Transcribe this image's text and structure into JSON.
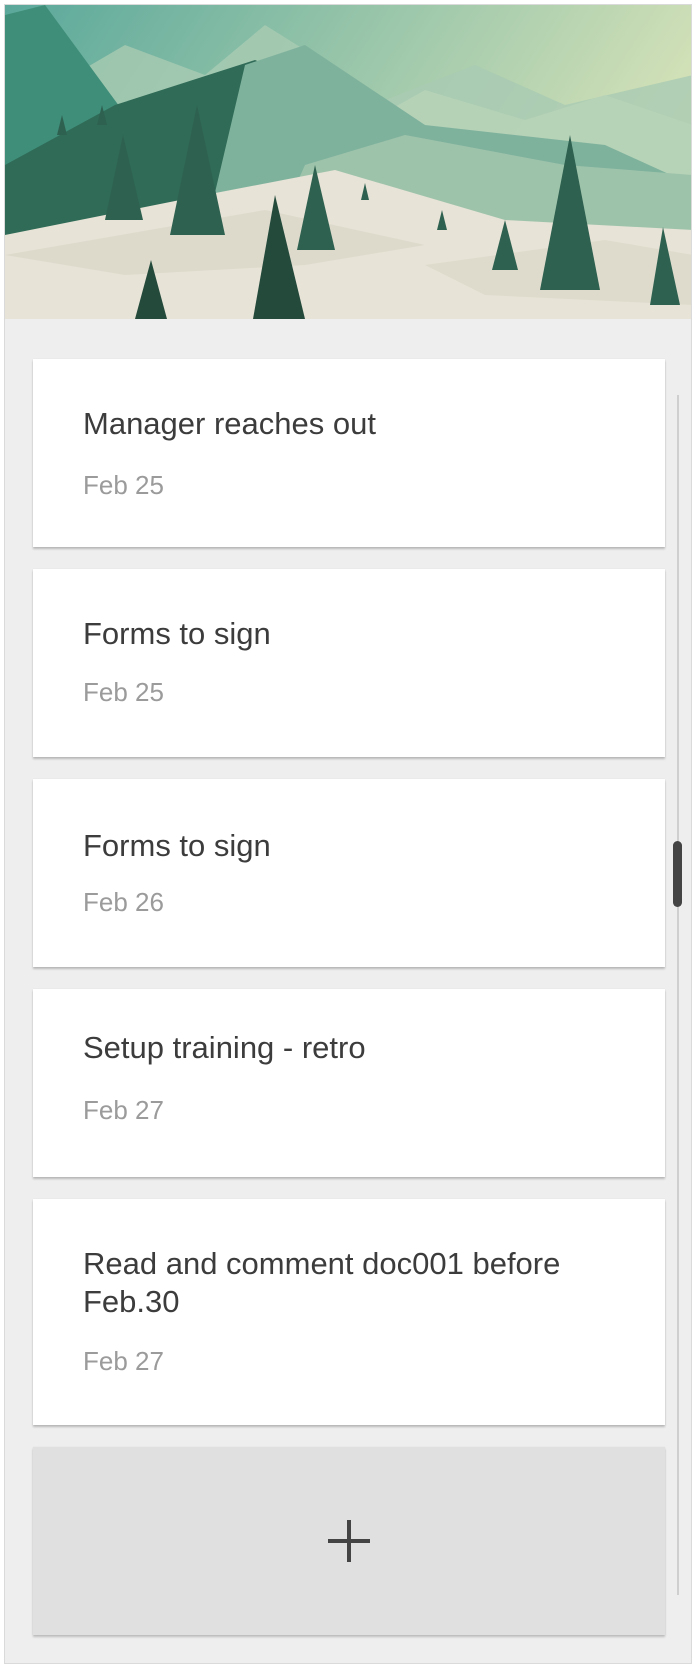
{
  "banner": {
    "icon": "mountain-landscape-illustration",
    "colors": {
      "sky_left": "#5aa89b",
      "sky_right": "#d5e2b8",
      "ridge_dark": "#2f6b57",
      "ridge_mid": "#5f9d86",
      "ridge_light": "#9ec3ab",
      "snow": "#e7e3d6",
      "tree_dark": "#244a3c",
      "tree": "#3f7a63"
    }
  },
  "cards": [
    {
      "title": "Manager reaches out",
      "date": "Feb 25"
    },
    {
      "title": "Forms to sign",
      "date": "Feb 25"
    },
    {
      "title": "Forms to sign",
      "date": "Feb 26"
    },
    {
      "title": "Setup training - retro",
      "date": "Feb 27"
    },
    {
      "title": "Read and comment doc001 before Feb.30",
      "date": "Feb 27"
    }
  ],
  "add_card": {
    "icon": "plus-icon"
  },
  "colors": {
    "panel_background": "#eeeeee",
    "card_background": "#ffffff",
    "title_text": "#3c3c3c",
    "date_text": "#9b9b9b",
    "add_card_background": "#e0e0e0"
  }
}
